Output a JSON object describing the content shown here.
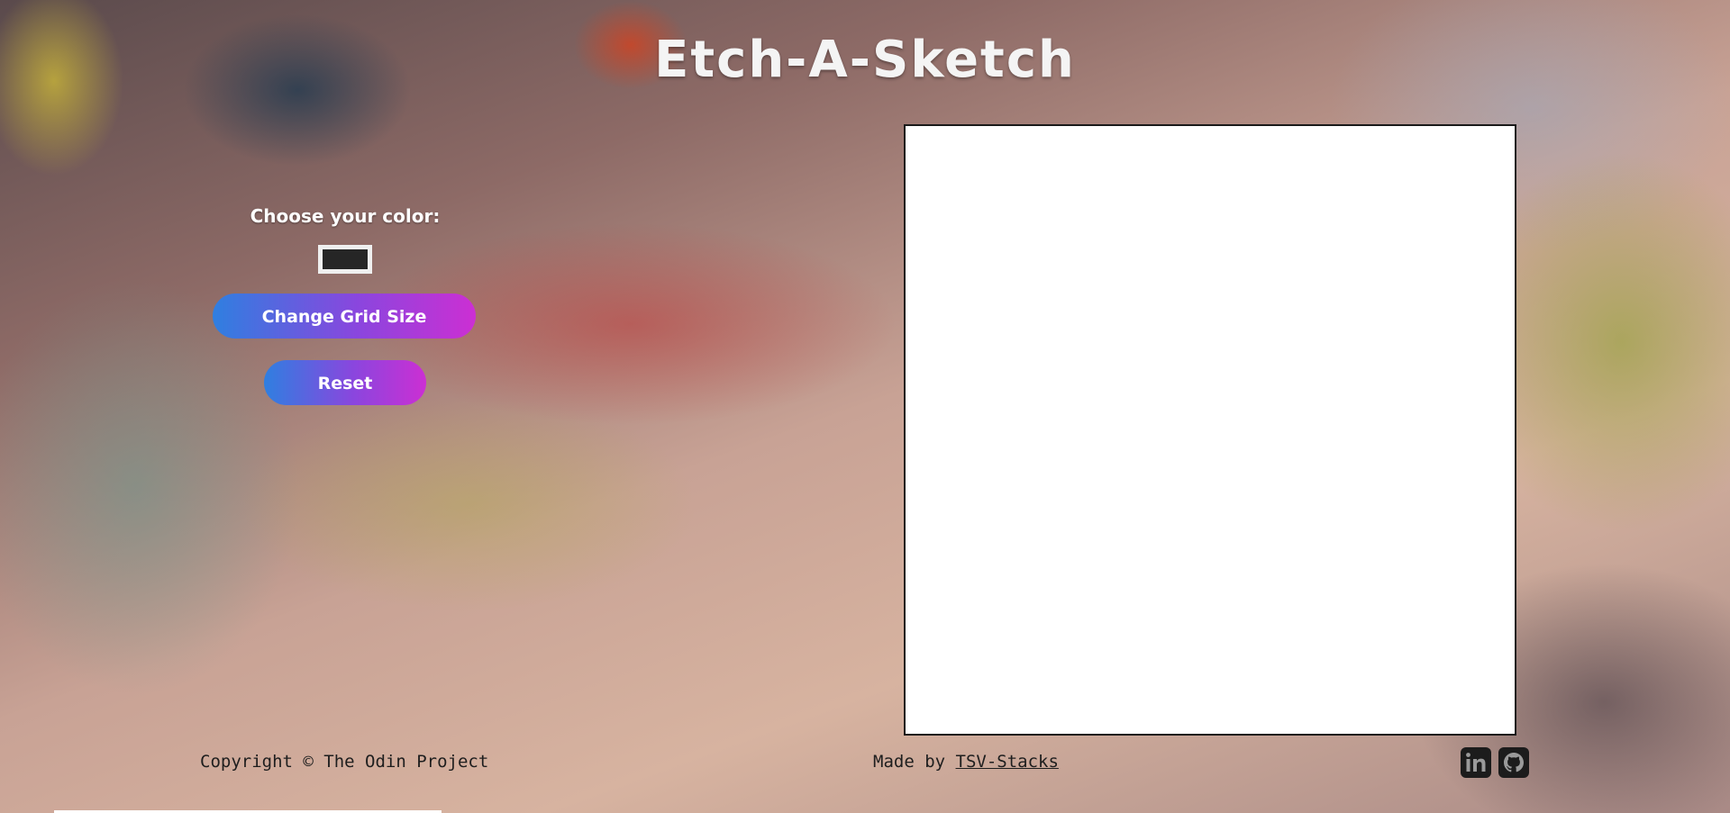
{
  "header": {
    "title": "Etch-A-Sketch"
  },
  "controls": {
    "color_label": "Choose your color:",
    "color_value": "#262626",
    "change_grid_label": "Change Grid Size",
    "reset_label": "Reset"
  },
  "footer": {
    "copyright": "Copyright © The Odin Project",
    "made_by_prefix": "Made by",
    "author_link": "TSV-Stacks"
  },
  "social": [
    {
      "name": "linkedin-icon",
      "text": "in"
    },
    {
      "name": "github-icon"
    }
  ],
  "colors": {
    "button_gradient_start": "#2f7fe0",
    "button_gradient_end": "#cc2fd3",
    "canvas_background": "#ffffff",
    "title": "#f4f4f4"
  }
}
